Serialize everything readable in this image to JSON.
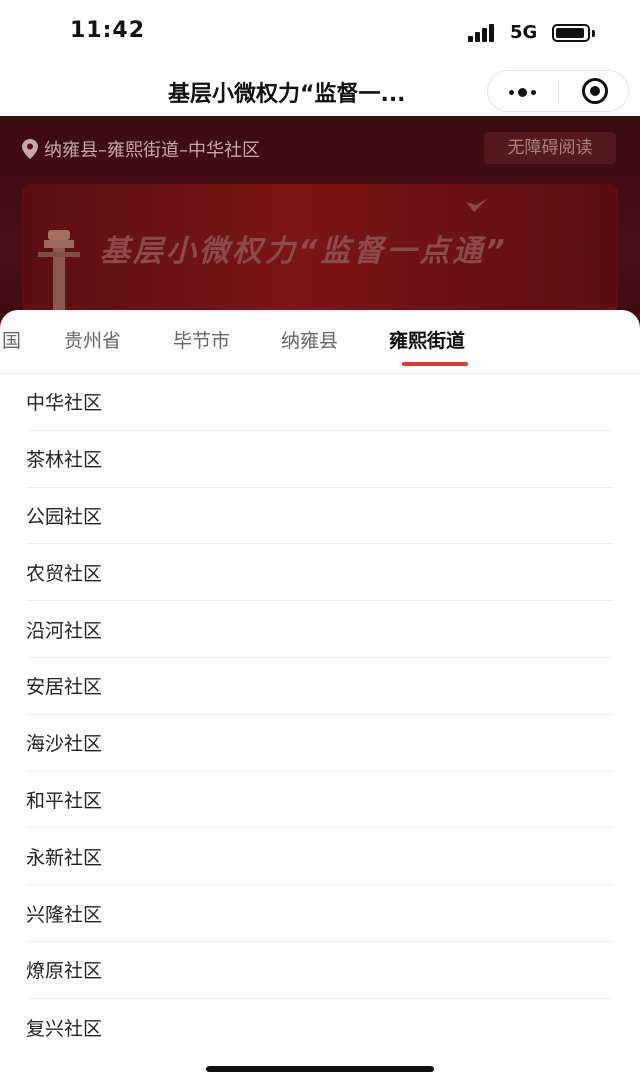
{
  "status_bar": {
    "time": "11:42",
    "network": "5G",
    "icons": [
      "signal-icon",
      "battery-icon"
    ]
  },
  "nav_bar": {
    "title": "基层小微权力“监督一...",
    "more_icon": "more-dots-icon",
    "close_icon": "close-target-icon"
  },
  "page": {
    "location_icon": "location-pin-icon",
    "location": "纳雍县–雍熙街道–中华社区",
    "accessibility_label": "无障碍阅读",
    "banner_text": "基层小微权力“监督一点通”"
  },
  "picker": {
    "tabs": [
      {
        "label": "国"
      },
      {
        "label": "贵州省"
      },
      {
        "label": "毕节市"
      },
      {
        "label": "纳雍县"
      },
      {
        "label": "雍熙街道"
      }
    ],
    "active_tab": "雍熙街道",
    "accent_color": "#d8373b",
    "items": [
      "中华社区",
      "茶林社区",
      "公园社区",
      "农贸社区",
      "沿河社区",
      "安居社区",
      "海沙社区",
      "和平社区",
      "永新社区",
      "兴隆社区",
      "燎原社区",
      "复兴社区"
    ]
  }
}
